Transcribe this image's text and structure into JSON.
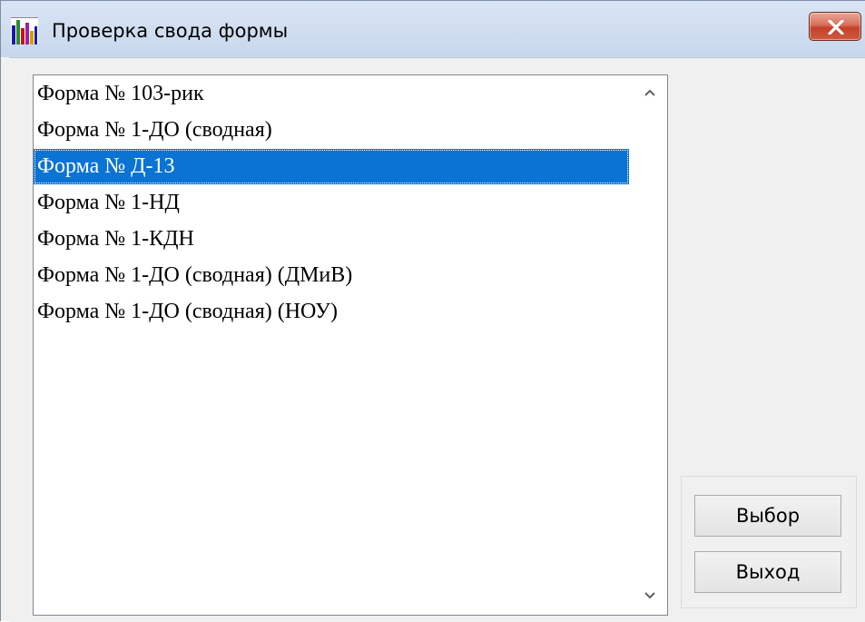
{
  "window": {
    "title": "Проверка свода формы",
    "icon": "bar-chart-icon",
    "close_icon": "close-icon"
  },
  "list": {
    "items": [
      {
        "label": "Форма № 103-рик",
        "selected": false
      },
      {
        "label": "Форма № 1-ДО (сводная)",
        "selected": false
      },
      {
        "label": "Форма № Д-13",
        "selected": true
      },
      {
        "label": "Форма № 1-НД",
        "selected": false
      },
      {
        "label": "Форма № 1-КДН",
        "selected": false
      },
      {
        "label": "Форма № 1-ДО (сводная) (ДМиВ)",
        "selected": false
      },
      {
        "label": "Форма № 1-ДО (сводная) (НОУ)",
        "selected": false
      }
    ],
    "selection_color": "#0a73d4"
  },
  "buttons": {
    "select_label": "Выбор",
    "exit_label": "Выход"
  },
  "colors": {
    "close_button": "#c4412a",
    "titlebar": "#d3e1f1"
  }
}
